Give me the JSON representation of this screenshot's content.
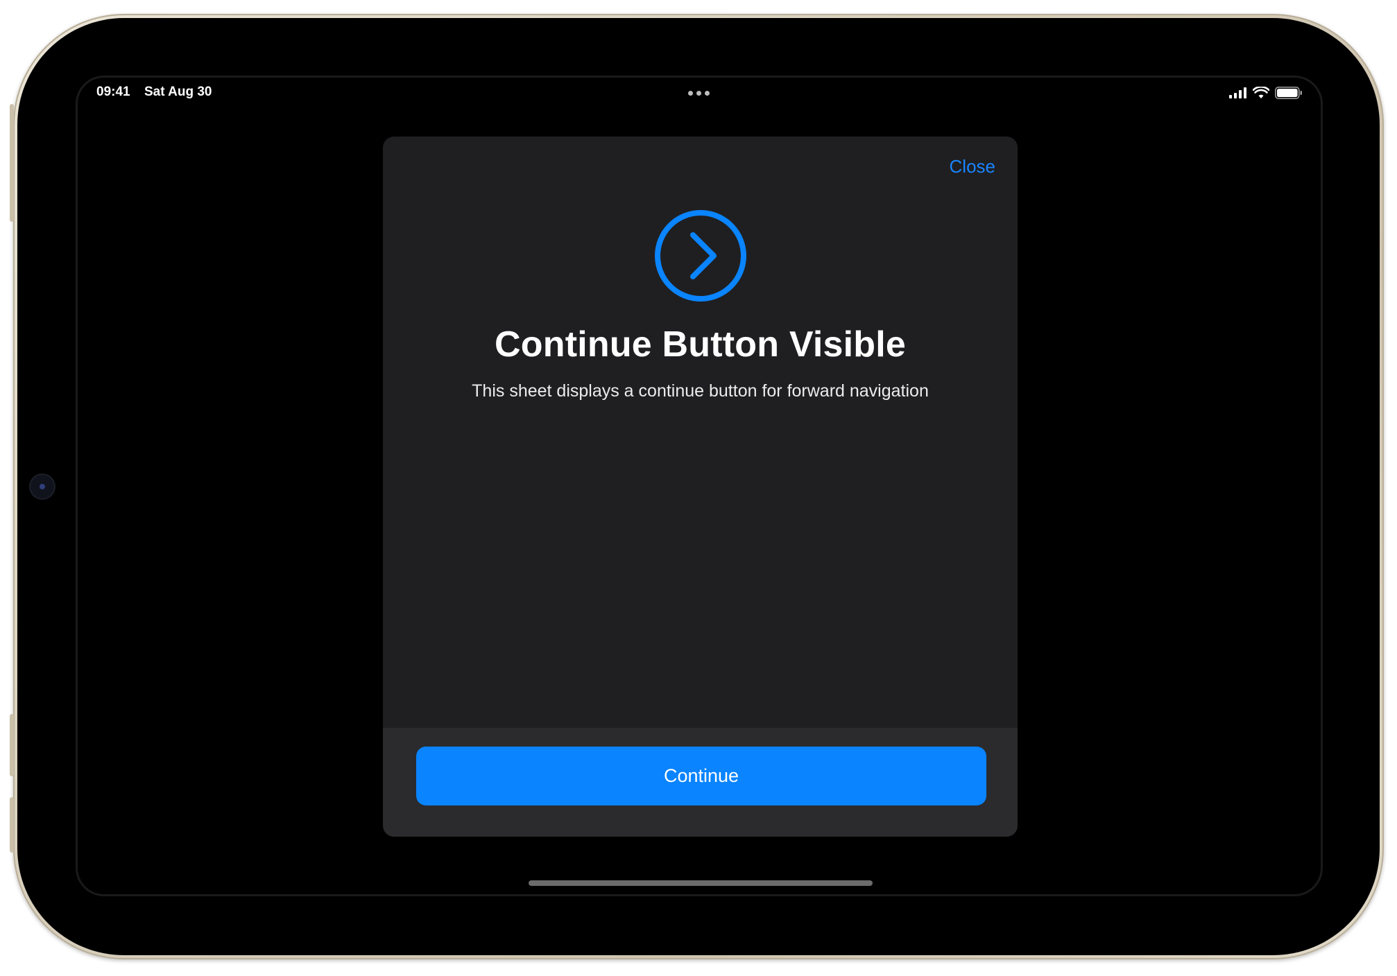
{
  "status_bar": {
    "time": "09:41",
    "date": "Sat Aug 30",
    "icons": [
      "signal-icon",
      "wifi-icon",
      "battery-icon"
    ]
  },
  "sheet": {
    "close_label": "Close",
    "hero_icon": "chevron-right-circle-icon",
    "title": "Continue Button Visible",
    "subtitle": "This sheet displays a continue button for forward navigation",
    "continue_label": "Continue"
  },
  "colors": {
    "accent": "#0a84ff",
    "link": "#1a84ff",
    "sheet_background": "#1f1f21",
    "footer_background": "#2b2b2d",
    "screen_background": "#000000"
  }
}
